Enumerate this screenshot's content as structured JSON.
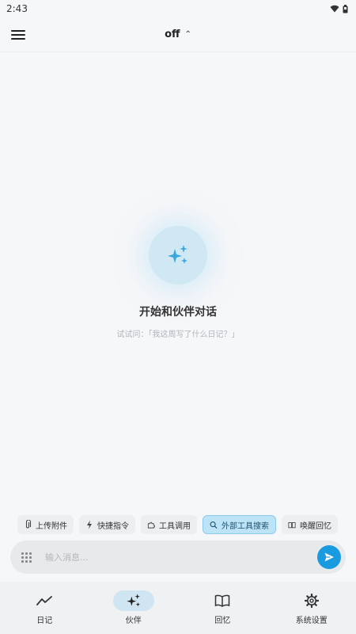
{
  "status": {
    "time": "2:43",
    "wifi_icon": "wifi-icon",
    "battery_icon": "battery-icon"
  },
  "header": {
    "model_value": "off",
    "menu_icon": "hamburger-menu-icon",
    "selector_icon": "up-down-chevron-icon"
  },
  "empty_state": {
    "icon": "sparkles-icon",
    "title": "开始和伙伴对话",
    "subtitle": "试试问：「我这周写了什么日记？」"
  },
  "chips": [
    {
      "label": "上传附件",
      "icon": "paperclip-icon",
      "active": false
    },
    {
      "label": "快捷指令",
      "icon": "lightning-icon",
      "active": false
    },
    {
      "label": "工具调用",
      "icon": "puzzle-icon",
      "active": false
    },
    {
      "label": "外部工具搜索",
      "icon": "search-icon",
      "active": true
    },
    {
      "label": "唤醒回忆",
      "icon": "book-icon",
      "active": false
    }
  ],
  "composer": {
    "placeholder": "输入消息...",
    "value": ""
  },
  "nav": {
    "items": [
      {
        "label": "日记",
        "icon": "trend-line-icon",
        "active": false
      },
      {
        "label": "伙伴",
        "icon": "sparkles-icon",
        "active": true
      },
      {
        "label": "回忆",
        "icon": "open-book-icon",
        "active": false
      },
      {
        "label": "系统设置",
        "icon": "gear-icon",
        "active": false
      }
    ]
  },
  "colors": {
    "accent": "#1a9be0",
    "active_chip_bg": "#bde4f6",
    "nav_active_bg": "#cfe5f1"
  }
}
